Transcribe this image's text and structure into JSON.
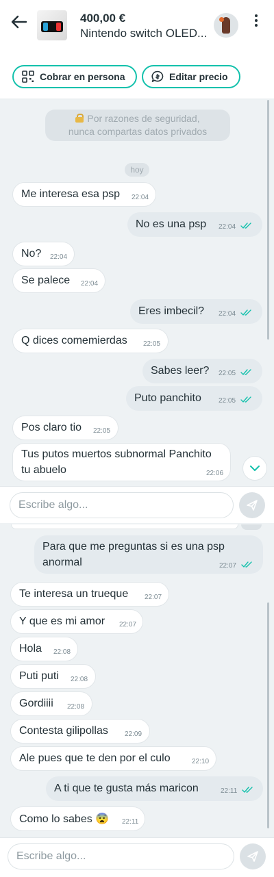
{
  "header": {
    "price": "400,00 €",
    "product_title": "Nintendo switch OLED..."
  },
  "actions": {
    "charge_in_person": "Cobrar en persona",
    "edit_price": "Editar precio"
  },
  "security_notice": {
    "line1": "Por razones de seguridad,",
    "line2": "nunca compartas datos privados"
  },
  "day_separator": "hoy",
  "screen1_messages": [
    {
      "dir": "in",
      "text": "Me interesa esa psp",
      "time": "22:04"
    },
    {
      "dir": "out",
      "text": "No es una psp",
      "time": "22:04"
    },
    {
      "dir": "in",
      "text": "No?",
      "time": "22:04"
    },
    {
      "dir": "in",
      "text": "Se palece",
      "time": "22:04"
    },
    {
      "dir": "out",
      "text": "Eres imbecil?",
      "time": "22:04"
    },
    {
      "dir": "in",
      "text": "Q dices comemierdas",
      "time": "22:05"
    },
    {
      "dir": "out",
      "text": "Sabes leer?",
      "time": "22:05"
    },
    {
      "dir": "out",
      "text": "Puto panchito",
      "time": "22:05"
    },
    {
      "dir": "in",
      "text": "Pos claro tio",
      "time": "22:05"
    },
    {
      "dir": "in",
      "line1": "Tus putos muertos subnormal Panchito",
      "line2": "tu abuelo",
      "time": "22:06"
    }
  ],
  "screen2_messages": [
    {
      "dir": "out",
      "line1": "Para que me preguntas si es una psp",
      "line2": "anormal",
      "time": "22:07"
    },
    {
      "dir": "in",
      "text": "Te interesa un trueque",
      "time": "22:07"
    },
    {
      "dir": "in",
      "text": "Y que es mi amor",
      "time": "22:07"
    },
    {
      "dir": "in",
      "text": "Hola",
      "time": "22:08"
    },
    {
      "dir": "in",
      "text": "Puti puti",
      "time": "22:08"
    },
    {
      "dir": "in",
      "text": "Gordiiii",
      "time": "22:08"
    },
    {
      "dir": "in",
      "text": "Contesta gilipollas",
      "time": "22:09"
    },
    {
      "dir": "in",
      "text": "Ale pues que te den por el culo",
      "time": "22:10"
    },
    {
      "dir": "out",
      "text": "A ti que te gusta más maricon",
      "time": "22:11"
    },
    {
      "dir": "in",
      "text": "Como lo sabes 😨",
      "time": "22:11"
    }
  ],
  "composer": {
    "placeholder": "Escribe algo..."
  },
  "colors": {
    "accent": "#13c1ac",
    "chat_background": "#eef2f4",
    "outgoing_bubble": "#e4eaee",
    "incoming_bubble": "#ffffff",
    "read_ticks": "#13c1ac"
  },
  "icons": [
    "back-arrow-icon",
    "more-vert-icon",
    "qr-code-icon",
    "price-tag-chat-icon",
    "lock-icon",
    "double-check-icon",
    "chevron-down-icon",
    "send-icon"
  ]
}
